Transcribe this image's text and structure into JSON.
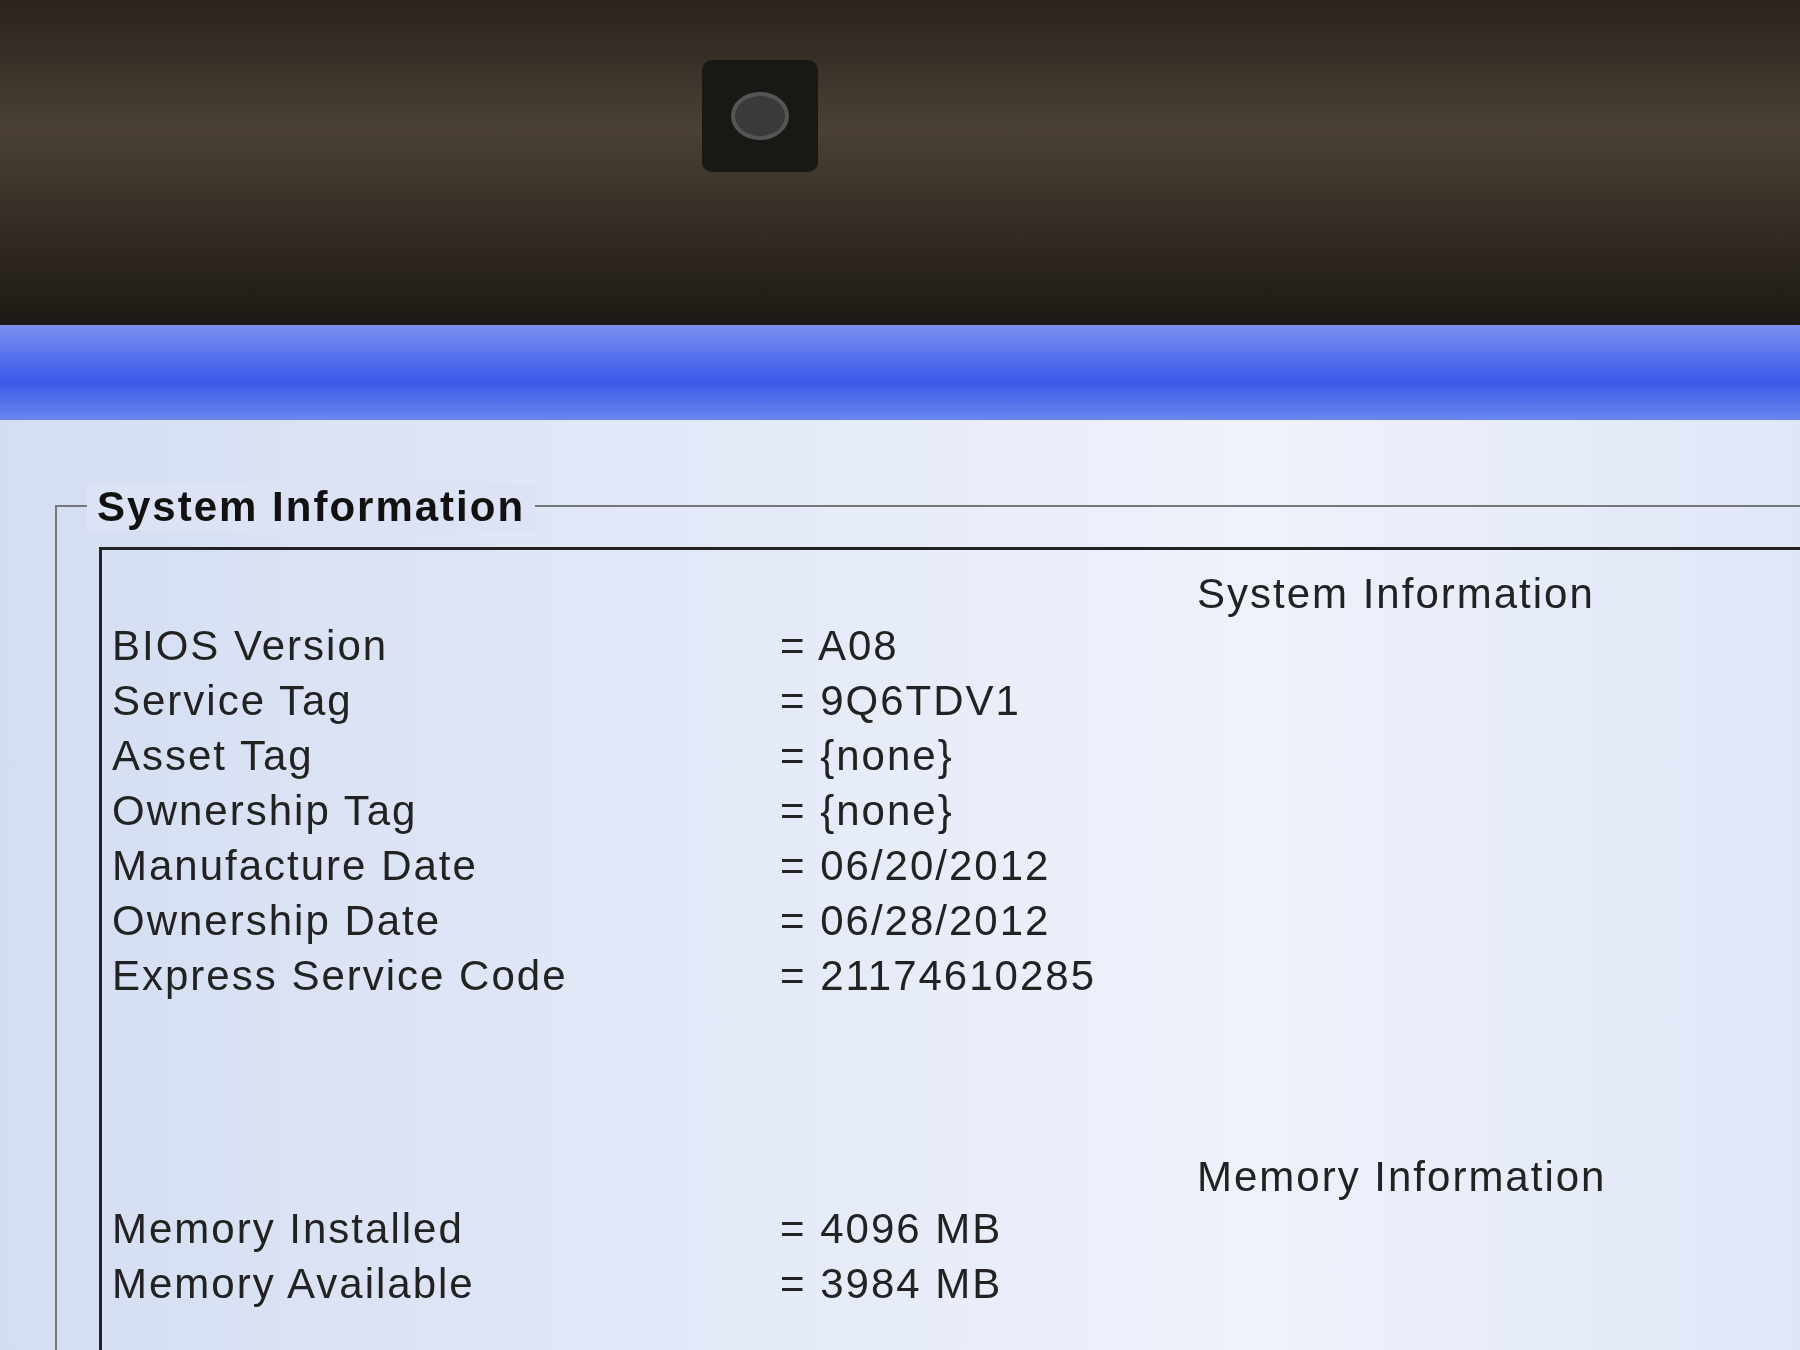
{
  "group_title": "System Information",
  "sections": [
    {
      "heading": "System Information",
      "rows": [
        {
          "label": "BIOS Version",
          "value": "= A08"
        },
        {
          "label": "Service Tag",
          "value": "= 9Q6TDV1"
        },
        {
          "label": "Asset Tag",
          "value": "= {none}"
        },
        {
          "label": "Ownership Tag",
          "value": "= {none}"
        },
        {
          "label": "Manufacture Date",
          "value": "= 06/20/2012"
        },
        {
          "label": "Ownership Date",
          "value": "= 06/28/2012"
        },
        {
          "label": "Express Service Code",
          "value": "= 21174610285"
        }
      ]
    },
    {
      "heading": "Memory Information",
      "rows": [
        {
          "label": "Memory Installed",
          "value": "= 4096 MB"
        },
        {
          "label": "Memory Available",
          "value": "= 3984 MB"
        }
      ]
    }
  ]
}
